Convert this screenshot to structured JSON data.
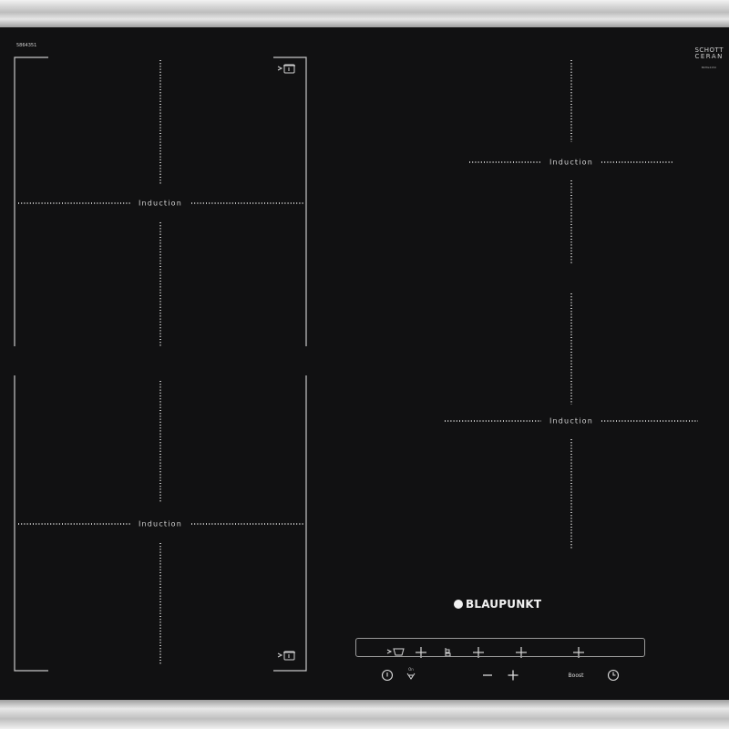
{
  "cooktop": {
    "model_number": "5864351",
    "schott_line1": "SCHOTT",
    "schott_line2": "CERAN",
    "schott_code": "BKHG4150",
    "brand": "BLAUPUNKT",
    "zones": [
      {
        "id": "left-top",
        "label": "Induction"
      },
      {
        "id": "left-bottom",
        "label": "Induction"
      },
      {
        "id": "right-top",
        "label": "Induction"
      },
      {
        "id": "right-bottom",
        "label": "Induction"
      }
    ],
    "controls": {
      "boost_label": "Boost",
      "plus_symbol": "+",
      "minus_symbol": "−",
      "timer_tiny_label": "On"
    }
  },
  "colors": {
    "glass": "#111112",
    "print": "#cfcfcf",
    "frame": "#c4c4c4"
  },
  "icons": [
    "flex-zone-pot-icon",
    "move-pot-icon",
    "power-icon",
    "wipe-protect-icon",
    "timer-icon",
    "pan-detect-icon"
  ]
}
